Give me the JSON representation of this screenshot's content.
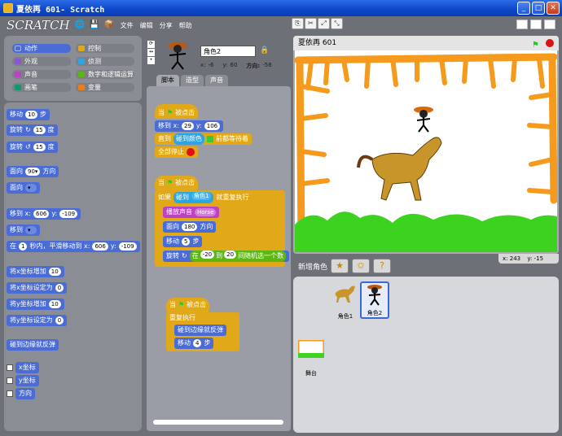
{
  "window": {
    "title": "夏依再 601- Scratch"
  },
  "menu": {
    "logo": "SCRATCH",
    "items": [
      "文件",
      "编辑",
      "分享",
      "帮助"
    ]
  },
  "categories": [
    {
      "label": "动作",
      "color": "#4a6cd4",
      "col": 0
    },
    {
      "label": "控制",
      "color": "#e1a91a",
      "col": 1
    },
    {
      "label": "外观",
      "color": "#8a55d7",
      "col": 0
    },
    {
      "label": "侦测",
      "color": "#2ca5e2",
      "col": 1
    },
    {
      "label": "声音",
      "color": "#bb42c3",
      "col": 0
    },
    {
      "label": "数字和逻辑运算",
      "color": "#5cb712",
      "col": 1
    },
    {
      "label": "画笔",
      "color": "#0e9a6c",
      "col": 0
    },
    {
      "label": "变量",
      "color": "#ee7d16",
      "col": 1
    }
  ],
  "palette": {
    "move": "移动",
    "move_n": "10",
    "move_unit": "步",
    "turn_r": "旋转",
    "turn_r_n": "15",
    "turn_r_unit": "度",
    "turn_l": "旋转",
    "turn_l_n": "15",
    "turn_l_unit": "度",
    "point_dir": "面向",
    "point_dir_n": "90▾",
    "point_dir_unit": "方向",
    "point_towards": "面向",
    "goto_xy": "移到 x:",
    "goto_x": "606",
    "goto_y_lbl": "y:",
    "goto_y": "-109",
    "goto": "移到",
    "glide": "在",
    "glide_n": "1",
    "glide_mid": "秒内，平滑移动到 x:",
    "glide_x": "606",
    "glide_y_lbl": "y:",
    "glide_y": "-109",
    "change_x": "将x坐标增加",
    "change_x_n": "10",
    "set_x": "将x坐标设定为",
    "set_x_n": "0",
    "change_y": "将y坐标增加",
    "change_y_n": "10",
    "set_y": "将y坐标设定为",
    "set_y_n": "0",
    "bounce": "碰到边缘就反弹",
    "rep_x": "x坐标",
    "rep_y": "y坐标",
    "rep_dir": "方向"
  },
  "sprite": {
    "name": "角色2",
    "x_label": "x:",
    "x": "-6",
    "y_label": "y:",
    "y": "60",
    "dir_label": "方向:",
    "dir": "-58"
  },
  "tabs": [
    "脚本",
    "造型",
    "声音"
  ],
  "scripts": {
    "s1": {
      "hat": "当",
      "hat2": "被点击",
      "goto": "移到 x:",
      "gx": "29",
      "gy_lbl": "y:",
      "gy": "106",
      "wait": "直到",
      "wait_cond": "碰到颜色",
      "wait_end": "前都等待着",
      "stop": "全部停止"
    },
    "s2": {
      "hat": "当",
      "hat2": "被点击",
      "forever_if": "如果",
      "touching": "碰到",
      "touch_target": "角色1",
      "forever_if_end": "就重复执行",
      "play": "播放声音",
      "sound": "Horse",
      "point": "面向",
      "pn": "180",
      "pdir": "方向",
      "move": "移动",
      "mn": "5",
      "mu": "步",
      "turn": "旋转",
      "turn_in": "在",
      "t_from": "-20",
      "t_to_lbl": "到",
      "t_to": "20",
      "t_end": "间随机选一个数"
    },
    "s3": {
      "hat": "当",
      "hat2": "被点击",
      "forever": "重复执行",
      "bounce": "碰到边缘就反弹",
      "move": "移动",
      "mn": "4",
      "mu": "步"
    }
  },
  "stage": {
    "title": "夏依再 601",
    "coord_x_lbl": "x:",
    "coord_x": "243",
    "coord_y_lbl": "y:",
    "coord_y": "-15"
  },
  "sprites_panel": {
    "new_label": "新增角色",
    "sprite1": "角色1",
    "sprite2": "角色2",
    "stage_label": "舞台"
  }
}
